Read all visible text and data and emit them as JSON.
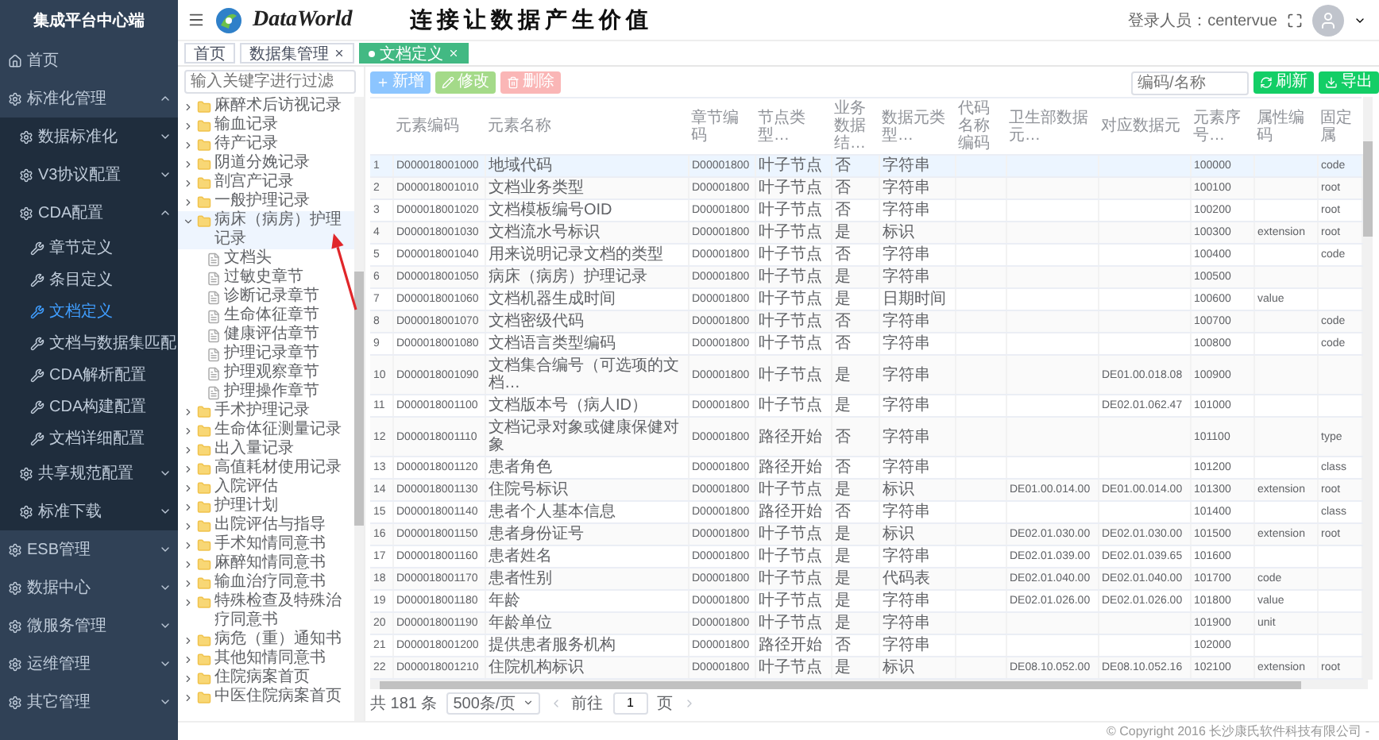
{
  "sidebar": {
    "title": "集成平台中心端",
    "items": [
      {
        "label": "首页",
        "selected": false
      },
      {
        "label": "标准化管理",
        "selected": false,
        "expanded": true,
        "children": [
          {
            "label": "数据标准化",
            "selected": false,
            "expanded": false
          },
          {
            "label": "V3协议配置",
            "selected": false,
            "expanded": false
          },
          {
            "label": "CDA配置",
            "selected": false,
            "expanded": true,
            "children": [
              {
                "label": "章节定义",
                "selected": false
              },
              {
                "label": "条目定义",
                "selected": false
              },
              {
                "label": "文档定义",
                "selected": true
              },
              {
                "label": "文档与数据集匹配",
                "selected": false
              },
              {
                "label": "CDA解析配置",
                "selected": false
              },
              {
                "label": "CDA构建配置",
                "selected": false
              },
              {
                "label": "文档详细配置",
                "selected": false
              }
            ]
          },
          {
            "label": "共享规范配置",
            "selected": false,
            "expanded": false
          },
          {
            "label": "标准下载",
            "selected": false,
            "expanded": false
          }
        ]
      },
      {
        "label": "ESB管理",
        "selected": false,
        "expanded": false
      },
      {
        "label": "数据中心",
        "selected": false,
        "expanded": false
      },
      {
        "label": "微服务管理",
        "selected": false,
        "expanded": false
      },
      {
        "label": "运维管理",
        "selected": false,
        "expanded": false
      },
      {
        "label": "其它管理",
        "selected": false,
        "expanded": false
      }
    ]
  },
  "header": {
    "logo_text": "DataWorld",
    "slogan": "连接让数据产生价值",
    "user_label": "登录人员：centervue"
  },
  "tabs": [
    {
      "label": "首页",
      "selected": false,
      "closable": false
    },
    {
      "label": "数据集管理",
      "selected": false,
      "closable": true
    },
    {
      "label": "文档定义",
      "selected": true,
      "closable": true
    }
  ],
  "tree": {
    "filter": {
      "placeholder": "输入关键字进行过滤"
    },
    "items": [
      {
        "label": "麻醉术后访视记录",
        "expanded": false,
        "selected": false
      },
      {
        "label": "输血记录",
        "expanded": false,
        "selected": false
      },
      {
        "label": "待产记录",
        "expanded": false,
        "selected": false
      },
      {
        "label": "阴道分娩记录",
        "expanded": false,
        "selected": false
      },
      {
        "label": "剖宫产记录",
        "expanded": false,
        "selected": false
      },
      {
        "label": "一般护理记录",
        "expanded": false,
        "selected": false
      },
      {
        "label": "病床（病房）护理记录",
        "expanded": true,
        "selected": true,
        "children": [
          {
            "label": "文档头",
            "selected": false
          },
          {
            "label": "过敏史章节",
            "selected": false
          },
          {
            "label": "诊断记录章节",
            "selected": false
          },
          {
            "label": "生命体征章节",
            "selected": false
          },
          {
            "label": "健康评估章节",
            "selected": false
          },
          {
            "label": "护理记录章节",
            "selected": false
          },
          {
            "label": "护理观察章节",
            "selected": false
          },
          {
            "label": "护理操作章节",
            "selected": false
          }
        ]
      },
      {
        "label": "手术护理记录",
        "expanded": false,
        "selected": false
      },
      {
        "label": "生命体征测量记录",
        "expanded": false,
        "selected": false
      },
      {
        "label": "出入量记录",
        "expanded": false,
        "selected": false
      },
      {
        "label": "高值耗材使用记录",
        "expanded": false,
        "selected": false
      },
      {
        "label": "入院评估",
        "expanded": false,
        "selected": false
      },
      {
        "label": "护理计划",
        "expanded": false,
        "selected": false
      },
      {
        "label": "出院评估与指导",
        "expanded": false,
        "selected": false
      },
      {
        "label": "手术知情同意书",
        "expanded": false,
        "selected": false
      },
      {
        "label": "麻醉知情同意书",
        "expanded": false,
        "selected": false
      },
      {
        "label": "输血治疗同意书",
        "expanded": false,
        "selected": false
      },
      {
        "label": "特殊检查及特殊治疗同意书",
        "expanded": false,
        "selected": false
      },
      {
        "label": "病危（重）通知书",
        "expanded": false,
        "selected": false
      },
      {
        "label": "其他知情同意书",
        "expanded": false,
        "selected": false
      },
      {
        "label": "住院病案首页",
        "expanded": false,
        "selected": false
      },
      {
        "label": "中医住院病案首页",
        "expanded": false,
        "selected": false
      }
    ]
  },
  "toolbar": {
    "buttons": [
      {
        "label": "新增",
        "kind": "add"
      },
      {
        "label": "修改",
        "kind": "edit"
      },
      {
        "label": "删除",
        "kind": "delete"
      }
    ],
    "search": {
      "placeholder": "编码/名称"
    },
    "actions": [
      {
        "label": "刷新",
        "kind": "refresh"
      },
      {
        "label": "导出",
        "kind": "export"
      }
    ]
  },
  "table": {
    "columns": [
      "元素编码",
      "元素名称",
      "章节编码",
      "节点类型…",
      "业务数据结…",
      "数据元类型…",
      "代码名称编码",
      "卫生部数据元…",
      "对应数据元",
      "元素序号…",
      "属性编码",
      "固定属"
    ],
    "rows": [
      {
        "index": "1",
        "selected": true,
        "cells": [
          "D000018001000",
          "地域代码",
          "D00001800",
          "叶子节点",
          "否",
          "字符串",
          null,
          null,
          null,
          "100000",
          null,
          "code"
        ]
      },
      {
        "index": "2",
        "selected": false,
        "cells": [
          "D000018001010",
          "文档业务类型",
          "D00001800",
          "叶子节点",
          "否",
          "字符串",
          null,
          null,
          null,
          "100100",
          null,
          "root"
        ]
      },
      {
        "index": "3",
        "selected": false,
        "cells": [
          "D000018001020",
          "文档模板编号OID",
          "D00001800",
          "叶子节点",
          "否",
          "字符串",
          null,
          null,
          null,
          "100200",
          null,
          "root"
        ]
      },
      {
        "index": "4",
        "selected": false,
        "cells": [
          "D000018001030",
          "文档流水号标识",
          "D00001800",
          "叶子节点",
          "是",
          "标识",
          null,
          null,
          null,
          "100300",
          "extension",
          "root"
        ]
      },
      {
        "index": "5",
        "selected": false,
        "cells": [
          "D000018001040",
          "用来说明记录文档的类型",
          "D00001800",
          "叶子节点",
          "否",
          "字符串",
          null,
          null,
          null,
          "100400",
          null,
          "code"
        ]
      },
      {
        "index": "6",
        "selected": false,
        "cells": [
          "D000018001050",
          "病床（病房）护理记录",
          "D00001800",
          "叶子节点",
          "是",
          "字符串",
          null,
          null,
          null,
          "100500",
          null,
          null
        ]
      },
      {
        "index": "7",
        "selected": false,
        "cells": [
          "D000018001060",
          "文档机器生成时间",
          "D00001800",
          "叶子节点",
          "是",
          "日期时间",
          null,
          null,
          null,
          "100600",
          "value",
          null
        ]
      },
      {
        "index": "8",
        "selected": false,
        "cells": [
          "D000018001070",
          "文档密级代码",
          "D00001800",
          "叶子节点",
          "否",
          "字符串",
          null,
          null,
          null,
          "100700",
          null,
          "code"
        ]
      },
      {
        "index": "9",
        "selected": false,
        "cells": [
          "D000018001080",
          "文档语言类型编码",
          "D00001800",
          "叶子节点",
          "否",
          "字符串",
          null,
          null,
          null,
          "100800",
          null,
          "code"
        ]
      },
      {
        "index": "10",
        "selected": false,
        "cells": [
          "D000018001090",
          "文档集合编号（可选项的文档…",
          "D00001800",
          "叶子节点",
          "是",
          "字符串",
          null,
          null,
          "DE01.00.018.08",
          "100900",
          null,
          null
        ]
      },
      {
        "index": "11",
        "selected": false,
        "cells": [
          "D000018001100",
          "文档版本号（病人ID）",
          "D00001800",
          "叶子节点",
          "是",
          "字符串",
          null,
          null,
          "DE02.01.062.47",
          "101000",
          null,
          null
        ]
      },
      {
        "index": "12",
        "selected": false,
        "cells": [
          "D000018001110",
          "文档记录对象或健康保健对象",
          "D00001800",
          "路径开始",
          "否",
          "字符串",
          null,
          null,
          null,
          "101100",
          null,
          "type"
        ]
      },
      {
        "index": "13",
        "selected": false,
        "cells": [
          "D000018001120",
          "患者角色",
          "D00001800",
          "路径开始",
          "否",
          "字符串",
          null,
          null,
          null,
          "101200",
          null,
          "class"
        ]
      },
      {
        "index": "14",
        "selected": false,
        "cells": [
          "D000018001130",
          "住院号标识",
          "D00001800",
          "叶子节点",
          "是",
          "标识",
          null,
          "DE01.00.014.00",
          "DE01.00.014.00",
          "101300",
          "extension",
          "root"
        ]
      },
      {
        "index": "15",
        "selected": false,
        "cells": [
          "D000018001140",
          "患者个人基本信息",
          "D00001800",
          "路径开始",
          "否",
          "字符串",
          null,
          null,
          null,
          "101400",
          null,
          "class"
        ]
      },
      {
        "index": "16",
        "selected": false,
        "cells": [
          "D000018001150",
          "患者身份证号",
          "D00001800",
          "叶子节点",
          "是",
          "标识",
          null,
          "DE02.01.030.00",
          "DE02.01.030.00",
          "101500",
          "extension",
          "root"
        ]
      },
      {
        "index": "17",
        "selected": false,
        "cells": [
          "D000018001160",
          "患者姓名",
          "D00001800",
          "叶子节点",
          "是",
          "字符串",
          null,
          "DE02.01.039.00",
          "DE02.01.039.65",
          "101600",
          null,
          null
        ]
      },
      {
        "index": "18",
        "selected": false,
        "cells": [
          "D000018001170",
          "患者性别",
          "D00001800",
          "叶子节点",
          "是",
          "代码表",
          null,
          "DE02.01.040.00",
          "DE02.01.040.00",
          "101700",
          "code",
          null
        ]
      },
      {
        "index": "19",
        "selected": false,
        "cells": [
          "D000018001180",
          "年龄",
          "D00001800",
          "叶子节点",
          "是",
          "字符串",
          null,
          "DE02.01.026.00",
          "DE02.01.026.00",
          "101800",
          "value",
          null
        ]
      },
      {
        "index": "20",
        "selected": false,
        "cells": [
          "D000018001190",
          "年龄单位",
          "D00001800",
          "叶子节点",
          "是",
          "字符串",
          null,
          null,
          null,
          "101900",
          "unit",
          null
        ]
      },
      {
        "index": "21",
        "selected": false,
        "cells": [
          "D000018001200",
          "提供患者服务机构",
          "D00001800",
          "路径开始",
          "否",
          "字符串",
          null,
          null,
          null,
          "102000",
          null,
          null
        ]
      },
      {
        "index": "22",
        "selected": false,
        "cells": [
          "D000018001210",
          "住院机构标识",
          "D00001800",
          "叶子节点",
          "是",
          "标识",
          null,
          "DE08.10.052.00",
          "DE08.10.052.16",
          "102100",
          "extension",
          "root"
        ]
      }
    ]
  },
  "pagination": {
    "total": "共 181 条",
    "page_size": "500条/页",
    "goto_label": "前往",
    "page": "1",
    "page_unit": "页"
  },
  "footer": {
    "copyright": "© Copyright 2016 长沙康氏软件科技有限公司 -"
  }
}
